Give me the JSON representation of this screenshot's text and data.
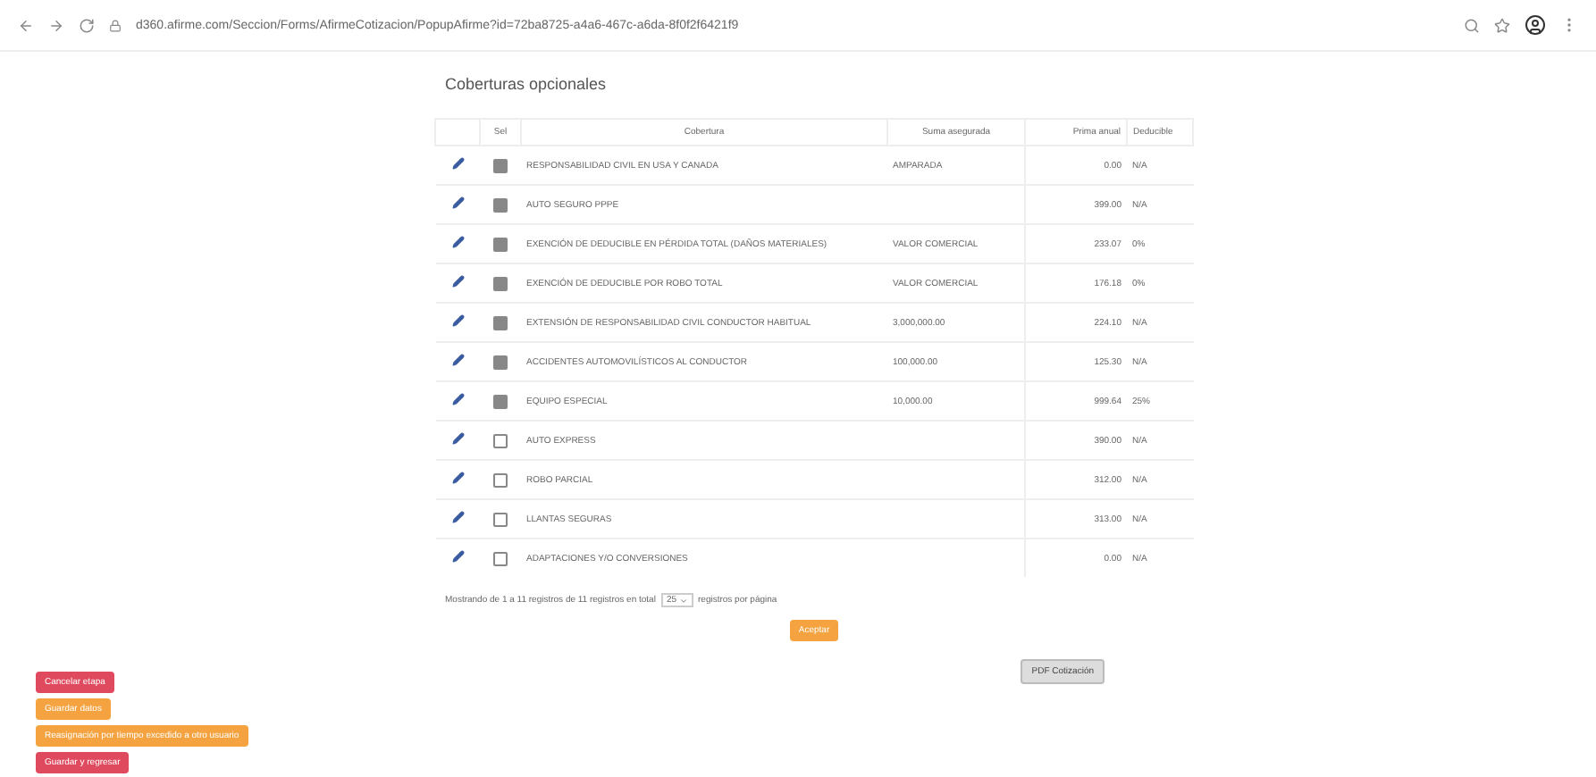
{
  "browser": {
    "url": "d360.afirme.com/Seccion/Forms/AfirmeCotizacion/PopupAfirme?id=72ba8725-a4a6-467c-a6da-8f0f2f6421f9"
  },
  "section_title": "Coberturas opcionales",
  "table": {
    "columns": [
      "",
      "Sel",
      "Cobertura",
      "Suma asegurada",
      "Prima anual",
      "Deducible"
    ],
    "rows": [
      {
        "checked": true,
        "cobertura": "RESPONSABILIDAD CIVIL EN USA Y CANADA",
        "suma": "AMPARADA",
        "prima": "0.00",
        "deducible": "N/A"
      },
      {
        "checked": true,
        "cobertura": "AUTO SEGURO PPPE",
        "suma": "",
        "prima": "399.00",
        "deducible": "N/A"
      },
      {
        "checked": true,
        "cobertura": "EXENCIÓN DE DEDUCIBLE EN PÉRDIDA TOTAL (DAÑOS MATERIALES)",
        "suma": "VALOR COMERCIAL",
        "prima": "233.07",
        "deducible": "0%"
      },
      {
        "checked": true,
        "cobertura": "EXENCIÓN DE DEDUCIBLE POR ROBO TOTAL",
        "suma": "VALOR COMERCIAL",
        "prima": "176.18",
        "deducible": "0%"
      },
      {
        "checked": true,
        "cobertura": "EXTENSIÓN DE RESPONSABILIDAD CIVIL CONDUCTOR HABITUAL",
        "suma": "3,000,000.00",
        "prima": "224.10",
        "deducible": "N/A"
      },
      {
        "checked": true,
        "cobertura": "ACCIDENTES AUTOMOVILÍSTICOS AL CONDUCTOR",
        "suma": "100,000.00",
        "prima": "125.30",
        "deducible": "N/A"
      },
      {
        "checked": true,
        "cobertura": "EQUIPO ESPECIAL",
        "suma": "10,000.00",
        "prima": "999.64",
        "deducible": "25%"
      },
      {
        "checked": false,
        "cobertura": "AUTO EXPRESS",
        "suma": "",
        "prima": "390.00",
        "deducible": "N/A"
      },
      {
        "checked": false,
        "cobertura": "ROBO PARCIAL",
        "suma": "",
        "prima": "312.00",
        "deducible": "N/A"
      },
      {
        "checked": false,
        "cobertura": "LLANTAS SEGURAS",
        "suma": "",
        "prima": "313.00",
        "deducible": "N/A"
      },
      {
        "checked": false,
        "cobertura": "ADAPTACIONES Y/O CONVERSIONES",
        "suma": "",
        "prima": "0.00",
        "deducible": "N/A"
      }
    ]
  },
  "pagination": {
    "before": "Mostrando de 1 a 11 registros de 11 registros en total",
    "page_size": "25",
    "after": "registros por página"
  },
  "accept_button": "Aceptar",
  "pdf_button": "PDF Cotización",
  "action_buttons": [
    {
      "label": "Cancelar etapa",
      "kind": "danger"
    },
    {
      "label": "Guardar datos",
      "kind": "warning"
    },
    {
      "label": "Reasignación por tiempo excedido a otro usuario",
      "kind": "warning"
    },
    {
      "label": "Guardar y regresar",
      "kind": "danger"
    }
  ]
}
